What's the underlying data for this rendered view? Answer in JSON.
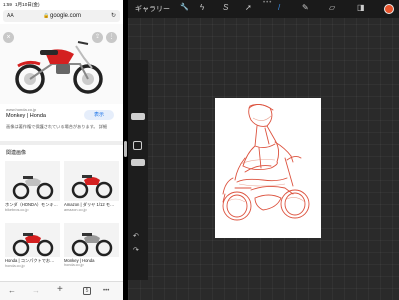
{
  "status": {
    "time": "1:59",
    "date": "1月10日(金)"
  },
  "safari": {
    "address": {
      "aa": "AA",
      "url": "google.com"
    },
    "image_viewer": {
      "close": "×",
      "share": "⇪",
      "more": "⋮"
    },
    "result": {
      "source": "www.honda.co.jp",
      "title": "Monkey | Honda",
      "visit": "表示",
      "notice": "画像は著作権で保護されている場合があります。 詳細"
    },
    "related_heading": "関連画像",
    "thumbs": [
      {
        "caption": "ホンダ（HONDA）モンキ…",
        "source": "bikebros.co.jp"
      },
      {
        "caption": "Amazon | ダリヤ 1/12 モ…",
        "source": "amazon.co.jp"
      },
      {
        "caption": "Honda | コンパクトでお…",
        "source": "honda.co.jp"
      },
      {
        "caption": "Monkey | Honda",
        "source": "honda.co.jp"
      }
    ],
    "toolbar": {
      "back": "←",
      "forward": "→",
      "new_tab": "+",
      "tabs": "5",
      "menu": "•••"
    }
  },
  "procreate": {
    "gallery": "ギャラリー",
    "tools": {
      "wrench": "🔧",
      "adjust": "⚡",
      "selection": "S",
      "transform": "➚",
      "brush": "/",
      "smudge": "✎",
      "eraser": "▭",
      "layers": "◨"
    },
    "top_dots": "•••",
    "undo": "↶",
    "redo": "↷",
    "colors": {
      "brand": "#e8542c",
      "sketch": "#d9402a"
    }
  }
}
